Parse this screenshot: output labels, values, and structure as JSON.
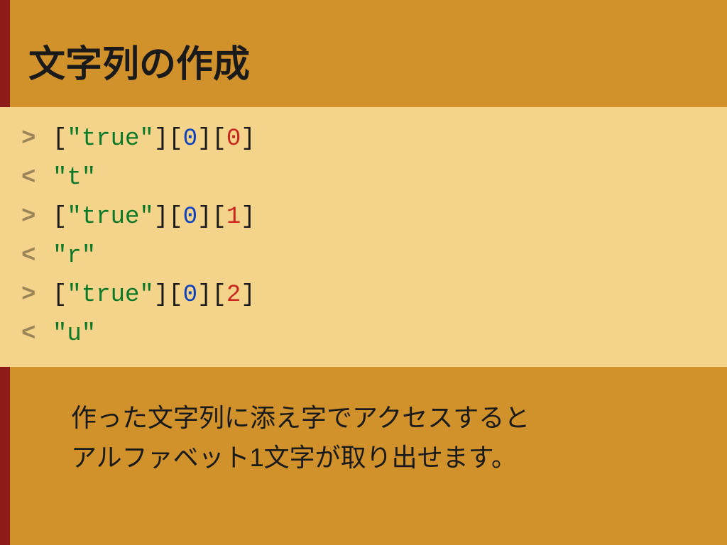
{
  "title": "文字列の作成",
  "code": {
    "lines": [
      {
        "marker": ">",
        "tokens": [
          {
            "t": "[",
            "c": "punc"
          },
          {
            "t": "\"true\"",
            "c": "str"
          },
          {
            "t": "][",
            "c": "punc"
          },
          {
            "t": "0",
            "c": "num"
          },
          {
            "t": "][",
            "c": "punc"
          },
          {
            "t": "0",
            "c": "hot"
          },
          {
            "t": "]",
            "c": "punc"
          }
        ]
      },
      {
        "marker": "<",
        "tokens": [
          {
            "t": "\"t\"",
            "c": "str"
          }
        ]
      },
      {
        "marker": ">",
        "tokens": [
          {
            "t": "[",
            "c": "punc"
          },
          {
            "t": "\"true\"",
            "c": "str"
          },
          {
            "t": "][",
            "c": "punc"
          },
          {
            "t": "0",
            "c": "num"
          },
          {
            "t": "][",
            "c": "punc"
          },
          {
            "t": "1",
            "c": "hot"
          },
          {
            "t": "]",
            "c": "punc"
          }
        ]
      },
      {
        "marker": "<",
        "tokens": [
          {
            "t": "\"r\"",
            "c": "str"
          }
        ]
      },
      {
        "marker": ">",
        "tokens": [
          {
            "t": "[",
            "c": "punc"
          },
          {
            "t": "\"true\"",
            "c": "str"
          },
          {
            "t": "][",
            "c": "punc"
          },
          {
            "t": "0",
            "c": "num"
          },
          {
            "t": "][",
            "c": "punc"
          },
          {
            "t": "2",
            "c": "hot"
          },
          {
            "t": "]",
            "c": "punc"
          }
        ]
      },
      {
        "marker": "<",
        "tokens": [
          {
            "t": "\"u\"",
            "c": "str"
          }
        ]
      }
    ]
  },
  "caption": {
    "line1": "作った文字列に添え字でアクセスすると",
    "line2": "アルファベット1文字が取り出せます。"
  },
  "colors": {
    "background": "#d2922b",
    "accent": "#8f1a1a",
    "code_bg": "#f4d38a",
    "string": "#0a7a28",
    "number": "#0a3fbf",
    "highlight_number": "#c9261e"
  }
}
